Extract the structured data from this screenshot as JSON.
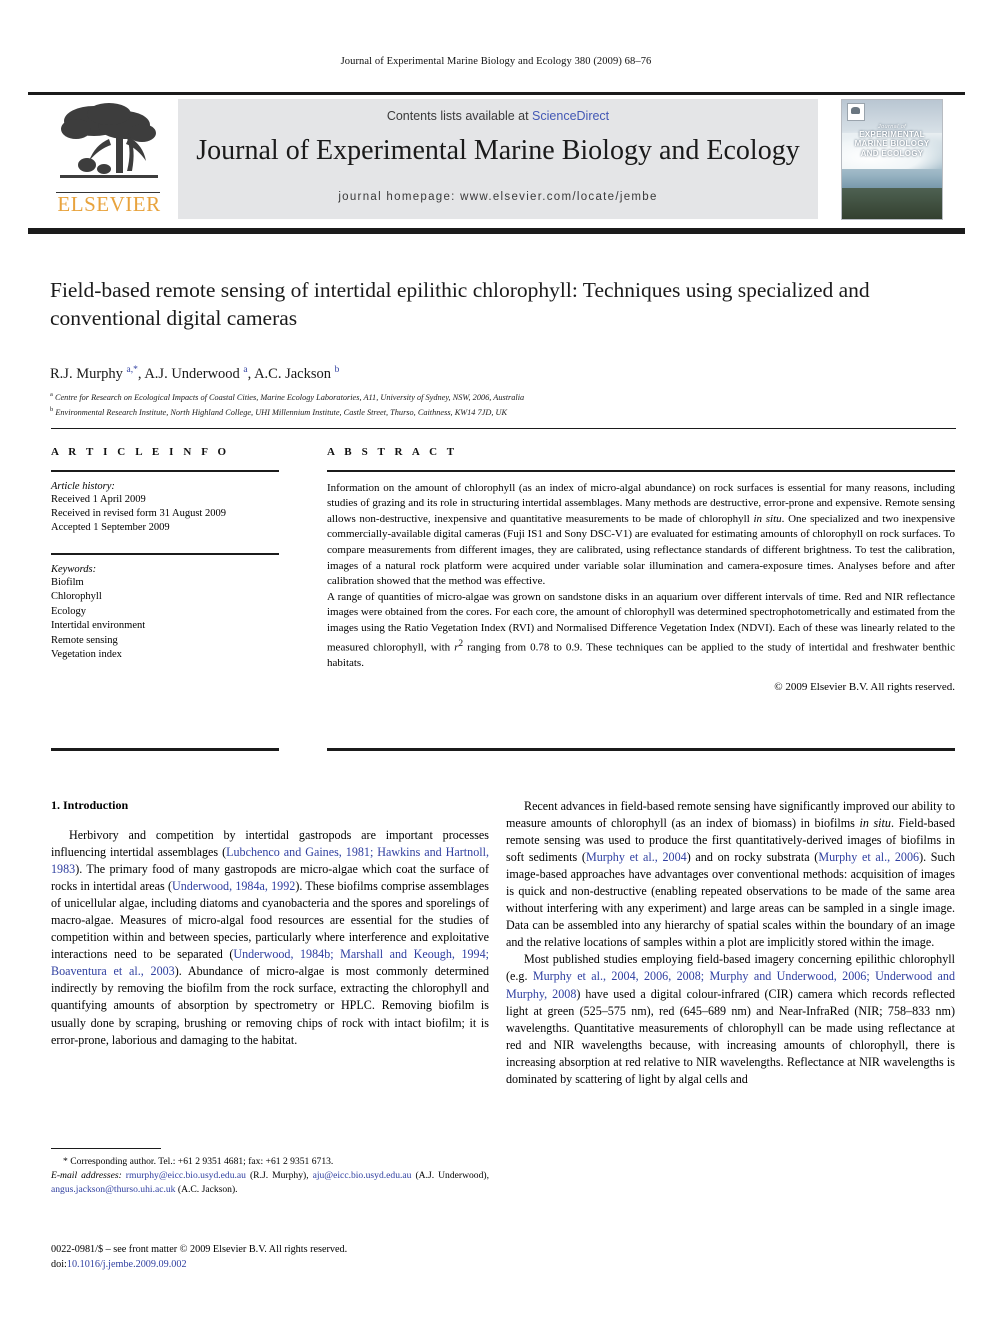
{
  "running_head": "Journal of Experimental Marine Biology and Ecology 380 (2009) 68–76",
  "masthead": {
    "contents_prefix": "Contents lists available at ",
    "sciencedirect": "ScienceDirect",
    "journal_title": "Journal of Experimental Marine Biology and Ecology",
    "homepage": "journal homepage: www.elsevier.com/locate/jembe",
    "publisher_name": "ELSEVIER",
    "cover": {
      "line1": "Journal of",
      "line2": "EXPERIMENTAL",
      "line3": "MARINE BIOLOGY",
      "line4": "AND ECOLOGY"
    }
  },
  "article": {
    "title": "Field-based remote sensing of intertidal epilithic chlorophyll: Techniques using specialized and conventional digital cameras",
    "authors_html": "R.J. Murphy <sup class=\"star\">a,*</sup>, A.J. Underwood <sup>a</sup>, A.C. Jackson <sup>b</sup>",
    "affiliation_a": "Centre for Research on Ecological Impacts of Coastal Cities, Marine Ecology Laboratories, A11, University of Sydney, NSW, 2006, Australia",
    "affiliation_b": "Environmental Research Institute, North Highland College, UHI Millennium Institute, Castle Street, Thurso, Caithness, KW14 7JD, UK"
  },
  "article_info": {
    "heading": "A R T I C L E    I N F O",
    "history_label": "Article history:",
    "history": [
      "Received 1 April 2009",
      "Received in revised form 31 August 2009",
      "Accepted 1 September 2009"
    ],
    "keywords_label": "Keywords:",
    "keywords": [
      "Biofilm",
      "Chlorophyll",
      "Ecology",
      "Intertidal environment",
      "Remote sensing",
      "Vegetation index"
    ]
  },
  "abstract": {
    "heading": "A B S T R A C T",
    "paragraph_1": "Information on the amount of chlorophyll (as an index of micro-algal abundance) on rock surfaces is essential for many reasons, including studies of grazing and its role in structuring intertidal assemblages. Many methods are destructive, error-prone and expensive. Remote sensing allows non-destructive, inexpensive and quantitative measurements to be made of chlorophyll in situ. One specialized and two inexpensive commercially-available digital cameras (Fuji IS1 and Sony DSC-V1) are evaluated for estimating amounts of chlorophyll on rock surfaces. To compare measurements from different images, they are calibrated, using reflectance standards of different brightness. To test the calibration, images of a natural rock platform were acquired under variable solar illumination and camera-exposure times. Analyses before and after calibration showed that the method was effective.",
    "paragraph_2": "A range of quantities of micro-algae was grown on sandstone disks in an aquarium over different intervals of time. Red and NIR reflectance images were obtained from the cores. For each core, the amount of chlorophyll was determined spectrophotometrically and estimated from the images using the Ratio Vegetation Index (RVI) and Normalised Difference Vegetation Index (NDVI). Each of these was linearly related to the measured chlorophyll, with r2 ranging from 0.78 to 0.9. These techniques can be applied to the study of intertidal and freshwater benthic habitats.",
    "copyright": "© 2009 Elsevier B.V. All rights reserved."
  },
  "body": {
    "section_heading": "1. Introduction",
    "left_paragraph_1_html": "Herbivory and competition by intertidal gastropods are important processes influencing intertidal assemblages (<span class=\"cite\">Lubchenco and Gaines, 1981; Hawkins and Hartnoll, 1983</span>). The primary food of many gastropods are micro-algae which coat the surface of rocks in intertidal areas (<span class=\"cite\">Underwood, 1984a, 1992</span>). These biofilms comprise assemblages of unicellular algae, including diatoms and cyanobacteria and the spores and sporelings of macro-algae. Measures of micro-algal food resources are essential for the studies of competition within and between species, particularly where interference and exploitative interactions need to be separated (<span class=\"cite\">Underwood, 1984b; Marshall and Keough, 1994; Boaventura et al., 2003</span>). Abundance of micro-algae is most commonly determined indirectly by removing the biofilm from the rock surface, extracting the chlorophyll and quantifying amounts of absorption by spectrometry or HPLC. Removing biofilm is usually done by scraping, brushing or removing chips of rock with intact biofilm; it is error-prone, laborious and damaging to the habitat.",
    "right_paragraph_1_html": "Recent advances in field-based remote sensing have significantly improved our ability to measure amounts of chlorophyll (as an index of biomass) in biofilms <span class=\"ital\">in situ</span>. Field-based remote sensing was used to produce the first quantitatively-derived images of biofilms in soft sediments (<span class=\"cite\">Murphy et al., 2004</span>) and on rocky substrata (<span class=\"cite\">Murphy et al., 2006</span>). Such image-based approaches have advantages over conventional methods: acquisition of images is quick and non-destructive (enabling repeated observations to be made of the same area without interfering with any experiment) and large areas can be sampled in a single image. Data can be assembled into any hierarchy of spatial scales within the boundary of an image and the relative locations of samples within a plot are implicitly stored within the image.",
    "right_paragraph_2_html": "Most published studies employing field-based imagery concerning epilithic chlorophyll (e.g. <span class=\"cite\">Murphy et al., 2004, 2006, 2008; Murphy and Underwood, 2006; Underwood and Murphy, 2008</span>) have used a digital colour-infrared (CIR) camera which records reflected light at green (525–575 nm), red (645–689 nm) and Near-InfraRed (NIR; 758–833 nm) wavelengths. Quantitative measurements of chlorophyll can be made using reflectance at red and NIR wavelengths because, with increasing amounts of chlorophyll, there is increasing absorption at red relative to NIR wavelengths. Reflectance at NIR wavelengths is dominated by scattering of light by algal cells and"
  },
  "footnote": {
    "corresponding_html": "* Corresponding author. Tel.: +61 2 9351 4681; fax: +61 2 9351 6713.",
    "emails_html": "<span class=\"fn-em\">E-mail addresses:</span> <span class=\"mail\">rmurphy@eicc.bio.usyd.edu.au</span> (R.J. Murphy), <span class=\"mail\">aju@eicc.bio.usyd.edu.au</span> (A.J. Underwood), <span class=\"mail\">angus.jackson@thurso.uhi.ac.uk</span> (A.C. Jackson)."
  },
  "imprint": {
    "issn_line": "0022-0981/$ – see front matter © 2009 Elsevier B.V. All rights reserved.",
    "doi_prefix": "doi:",
    "doi": "10.1016/j.jembe.2009.09.002"
  },
  "colors": {
    "link_blue": "#2f3fa0",
    "sciencedirect_blue": "#4358b5",
    "elsevier_orange": "#E8A33D",
    "banner_gray": "#e4e5e7",
    "rule_black": "#1b1b1b"
  }
}
